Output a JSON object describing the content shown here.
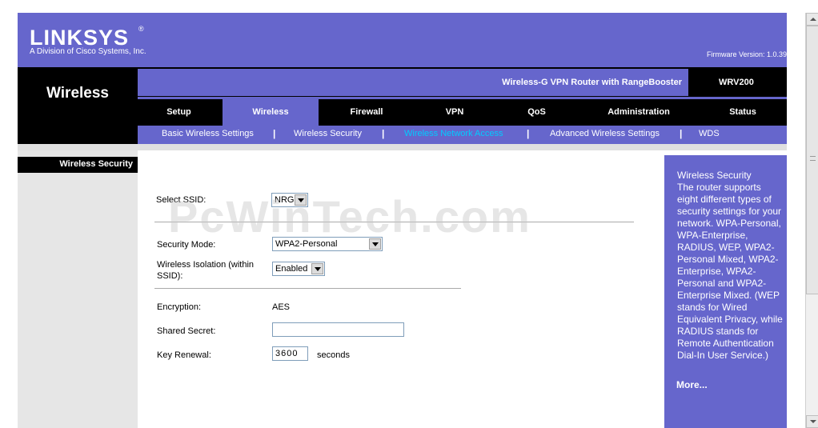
{
  "header": {
    "logo": "LINKSYS",
    "logo_reg": "®",
    "logo_sub": "A Division of Cisco Systems, Inc.",
    "firmware": "Firmware Version: 1.0.39"
  },
  "section_title": "Wireless",
  "product": {
    "name": "Wireless-G VPN Router with RangeBooster",
    "model": "WRV200"
  },
  "main_tabs": [
    "Setup",
    "Wireless",
    "Firewall",
    "VPN",
    "QoS",
    "Administration",
    "Status"
  ],
  "sub_tabs": [
    "Basic Wireless Settings",
    "Wireless Security",
    "Wireless Network Access",
    "Advanced Wireless Settings",
    "WDS"
  ],
  "left_label": "Wireless Security",
  "form": {
    "ssid_label": "Select SSID:",
    "ssid_value": "NRG",
    "security_mode_label": "Security Mode:",
    "security_mode_value": "WPA2-Personal",
    "isolation_label_1": "Wireless Isolation (within",
    "isolation_label_2": "SSID):",
    "isolation_value": "Enabled",
    "encryption_label": "Encryption:",
    "encryption_value": "AES",
    "shared_secret_label": "Shared Secret:",
    "shared_secret_value": "",
    "key_renewal_label": "Key Renewal:",
    "key_renewal_value": "3600",
    "key_renewal_unit": "seconds"
  },
  "help": {
    "title": "Wireless Security",
    "text": "The router supports eight different types of security settings for your network. WPA-Personal, WPA-Enterprise, RADIUS, WEP, WPA2-Personal Mixed, WPA2-Enterprise, WPA2-Personal and WPA2-Enterprise Mixed. (WEP stands for Wired Equivalent Privacy, while RADIUS stands for Remote Authentication Dial-In User Service.)",
    "more": "More..."
  },
  "watermark": "PcWinTech.com",
  "colors": {
    "brand_purple": "#6666cc",
    "active_subtab": "#00ccff"
  }
}
